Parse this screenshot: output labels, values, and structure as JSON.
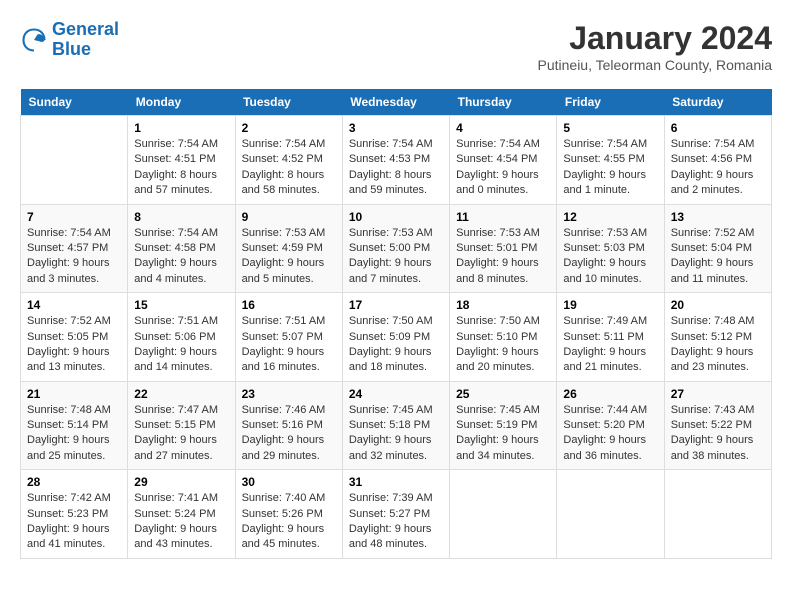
{
  "header": {
    "logo_line1": "General",
    "logo_line2": "Blue",
    "month_year": "January 2024",
    "location": "Putineiu, Teleorman County, Romania"
  },
  "calendar": {
    "days_of_week": [
      "Sunday",
      "Monday",
      "Tuesday",
      "Wednesday",
      "Thursday",
      "Friday",
      "Saturday"
    ],
    "weeks": [
      [
        {
          "day": "",
          "info": ""
        },
        {
          "day": "1",
          "info": "Sunrise: 7:54 AM\nSunset: 4:51 PM\nDaylight: 8 hours\nand 57 minutes."
        },
        {
          "day": "2",
          "info": "Sunrise: 7:54 AM\nSunset: 4:52 PM\nDaylight: 8 hours\nand 58 minutes."
        },
        {
          "day": "3",
          "info": "Sunrise: 7:54 AM\nSunset: 4:53 PM\nDaylight: 8 hours\nand 59 minutes."
        },
        {
          "day": "4",
          "info": "Sunrise: 7:54 AM\nSunset: 4:54 PM\nDaylight: 9 hours\nand 0 minutes."
        },
        {
          "day": "5",
          "info": "Sunrise: 7:54 AM\nSunset: 4:55 PM\nDaylight: 9 hours\nand 1 minute."
        },
        {
          "day": "6",
          "info": "Sunrise: 7:54 AM\nSunset: 4:56 PM\nDaylight: 9 hours\nand 2 minutes."
        }
      ],
      [
        {
          "day": "7",
          "info": "Sunrise: 7:54 AM\nSunset: 4:57 PM\nDaylight: 9 hours\nand 3 minutes."
        },
        {
          "day": "8",
          "info": "Sunrise: 7:54 AM\nSunset: 4:58 PM\nDaylight: 9 hours\nand 4 minutes."
        },
        {
          "day": "9",
          "info": "Sunrise: 7:53 AM\nSunset: 4:59 PM\nDaylight: 9 hours\nand 5 minutes."
        },
        {
          "day": "10",
          "info": "Sunrise: 7:53 AM\nSunset: 5:00 PM\nDaylight: 9 hours\nand 7 minutes."
        },
        {
          "day": "11",
          "info": "Sunrise: 7:53 AM\nSunset: 5:01 PM\nDaylight: 9 hours\nand 8 minutes."
        },
        {
          "day": "12",
          "info": "Sunrise: 7:53 AM\nSunset: 5:03 PM\nDaylight: 9 hours\nand 10 minutes."
        },
        {
          "day": "13",
          "info": "Sunrise: 7:52 AM\nSunset: 5:04 PM\nDaylight: 9 hours\nand 11 minutes."
        }
      ],
      [
        {
          "day": "14",
          "info": "Sunrise: 7:52 AM\nSunset: 5:05 PM\nDaylight: 9 hours\nand 13 minutes."
        },
        {
          "day": "15",
          "info": "Sunrise: 7:51 AM\nSunset: 5:06 PM\nDaylight: 9 hours\nand 14 minutes."
        },
        {
          "day": "16",
          "info": "Sunrise: 7:51 AM\nSunset: 5:07 PM\nDaylight: 9 hours\nand 16 minutes."
        },
        {
          "day": "17",
          "info": "Sunrise: 7:50 AM\nSunset: 5:09 PM\nDaylight: 9 hours\nand 18 minutes."
        },
        {
          "day": "18",
          "info": "Sunrise: 7:50 AM\nSunset: 5:10 PM\nDaylight: 9 hours\nand 20 minutes."
        },
        {
          "day": "19",
          "info": "Sunrise: 7:49 AM\nSunset: 5:11 PM\nDaylight: 9 hours\nand 21 minutes."
        },
        {
          "day": "20",
          "info": "Sunrise: 7:48 AM\nSunset: 5:12 PM\nDaylight: 9 hours\nand 23 minutes."
        }
      ],
      [
        {
          "day": "21",
          "info": "Sunrise: 7:48 AM\nSunset: 5:14 PM\nDaylight: 9 hours\nand 25 minutes."
        },
        {
          "day": "22",
          "info": "Sunrise: 7:47 AM\nSunset: 5:15 PM\nDaylight: 9 hours\nand 27 minutes."
        },
        {
          "day": "23",
          "info": "Sunrise: 7:46 AM\nSunset: 5:16 PM\nDaylight: 9 hours\nand 29 minutes."
        },
        {
          "day": "24",
          "info": "Sunrise: 7:45 AM\nSunset: 5:18 PM\nDaylight: 9 hours\nand 32 minutes."
        },
        {
          "day": "25",
          "info": "Sunrise: 7:45 AM\nSunset: 5:19 PM\nDaylight: 9 hours\nand 34 minutes."
        },
        {
          "day": "26",
          "info": "Sunrise: 7:44 AM\nSunset: 5:20 PM\nDaylight: 9 hours\nand 36 minutes."
        },
        {
          "day": "27",
          "info": "Sunrise: 7:43 AM\nSunset: 5:22 PM\nDaylight: 9 hours\nand 38 minutes."
        }
      ],
      [
        {
          "day": "28",
          "info": "Sunrise: 7:42 AM\nSunset: 5:23 PM\nDaylight: 9 hours\nand 41 minutes."
        },
        {
          "day": "29",
          "info": "Sunrise: 7:41 AM\nSunset: 5:24 PM\nDaylight: 9 hours\nand 43 minutes."
        },
        {
          "day": "30",
          "info": "Sunrise: 7:40 AM\nSunset: 5:26 PM\nDaylight: 9 hours\nand 45 minutes."
        },
        {
          "day": "31",
          "info": "Sunrise: 7:39 AM\nSunset: 5:27 PM\nDaylight: 9 hours\nand 48 minutes."
        },
        {
          "day": "",
          "info": ""
        },
        {
          "day": "",
          "info": ""
        },
        {
          "day": "",
          "info": ""
        }
      ]
    ]
  }
}
